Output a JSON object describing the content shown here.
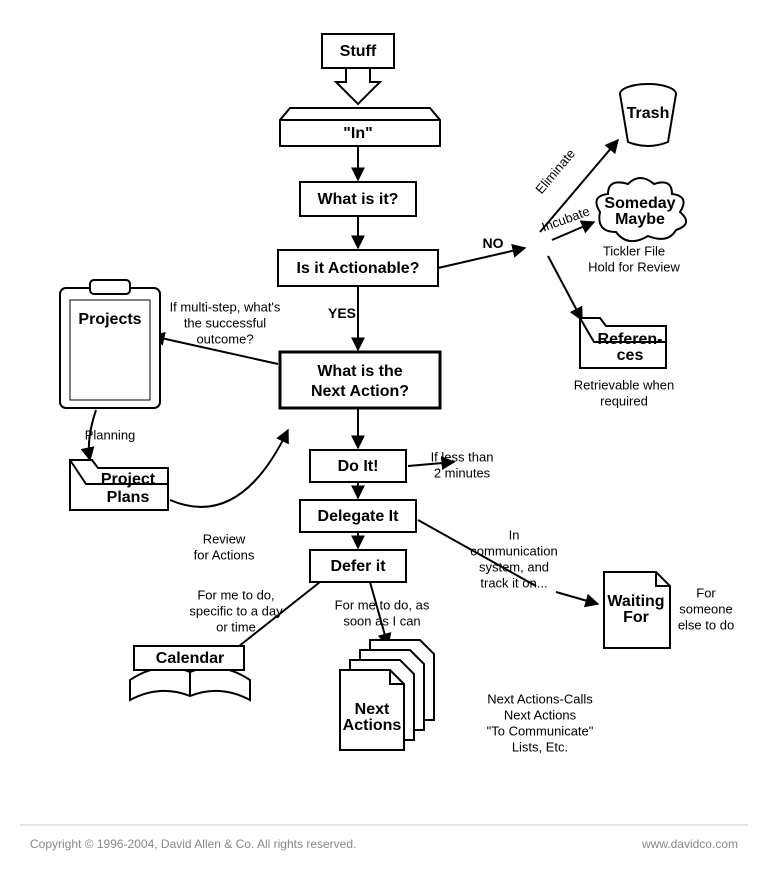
{
  "title": "GTD Workflow",
  "nodes": {
    "stuff": "Stuff",
    "inbox": "\"In\"",
    "what_is_it": "What is it?",
    "actionable": "Is it Actionable?",
    "next_action_l1": "What is the",
    "next_action_l2": "Next Action?",
    "do_it": "Do It!",
    "delegate_it": "Delegate It",
    "defer_it": "Defer it",
    "projects": "Projects",
    "project_plans_l1": "Project",
    "project_plans_l2": "Plans",
    "trash": "Trash",
    "someday_l1": "Someday",
    "someday_l2": "Maybe",
    "references_l1": "Referen-",
    "references_l2": "ces",
    "waiting_l1": "Waiting",
    "waiting_l2": "For",
    "calendar": "Calendar",
    "next_actions_l1": "Next",
    "next_actions_l2": "Actions"
  },
  "labels": {
    "yes": "YES",
    "no": "NO",
    "eliminate": "Eliminate",
    "incubate": "Incubate",
    "tickler_l1": "Tickler File",
    "tickler_l2": "Hold for Review",
    "retrievable_l1": "Retrievable when",
    "retrievable_l2": "required",
    "multistep_l1": "If multi-step, what's",
    "multistep_l2": "the successful",
    "multistep_l3": "outcome?",
    "planning": "Planning",
    "review_l1": "Review",
    "review_l2": "for Actions",
    "two_min_l1": "If less than",
    "two_min_l2": "2 minutes",
    "in_comm_l1": "In",
    "in_comm_l2": "communication",
    "in_comm_l3": "system, and",
    "in_comm_l4": "track it on...",
    "for_me_day_l1": "For me to do,",
    "for_me_day_l2": "specific to a day",
    "for_me_day_l3": "or time",
    "for_me_soon_l1": "For me to do, as",
    "for_me_soon_l2": "soon as I can",
    "for_someone_l1": "For",
    "for_someone_l2": "someone",
    "for_someone_l3": "else to do",
    "lists_l1": "Next Actions-Calls",
    "lists_l2": "Next Actions",
    "lists_l3": "\"To Communicate\"",
    "lists_l4": "Lists, Etc."
  },
  "footer": {
    "copyright": "Copyright  © 1996-2004, David Allen & Co.  All rights reserved.",
    "url": "www.davidco.com"
  }
}
